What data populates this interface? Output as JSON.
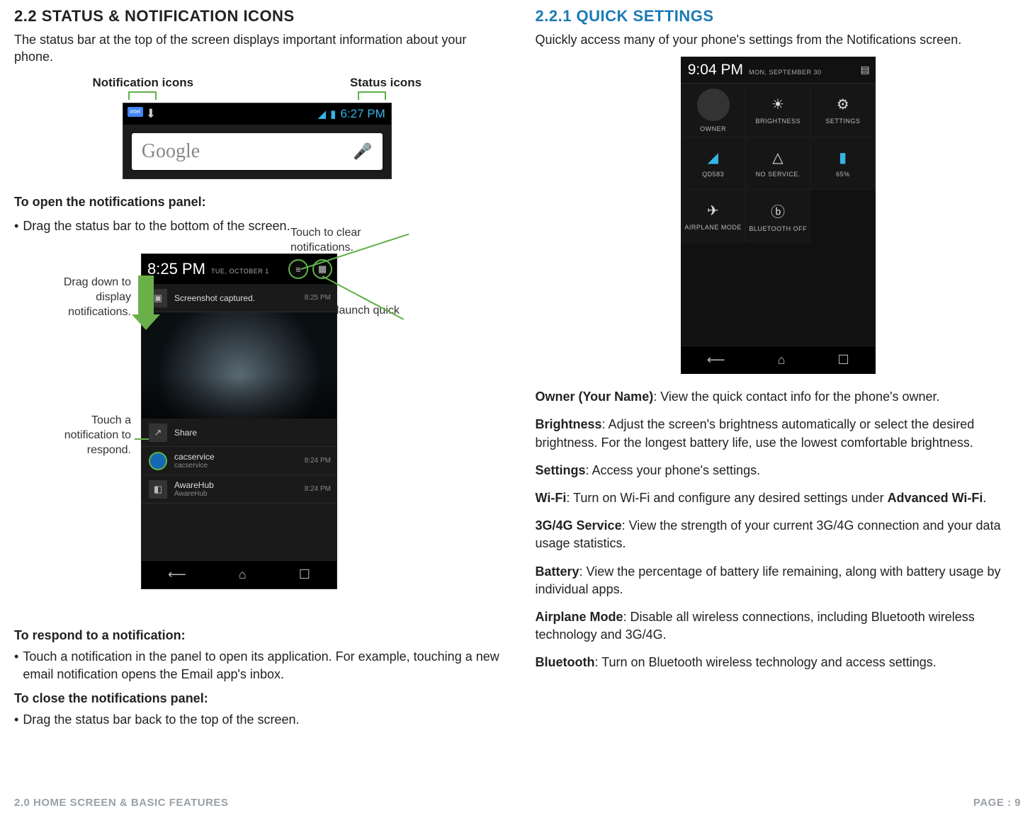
{
  "left": {
    "heading": "2.2 STATUS & NOTIFICATION ICONS",
    "intro": "The status bar at the top of the screen displays important information about your phone.",
    "labels": {
      "notif": "Notification icons",
      "status": "Status icons"
    },
    "fig1": {
      "clock": "6:27 PM",
      "search_brand": "Google",
      "intel": "intel"
    },
    "open_heading": "To open the notifications panel:",
    "open_bullet": "Drag the status bar to the bottom of the screen.",
    "fig2": {
      "time": "8:25 PM",
      "date": "TUE, OCTOBER 1",
      "row1": {
        "title": "Screenshot captured.",
        "ts": "8:25 PM"
      },
      "share": "Share",
      "row2": {
        "title": "cacservice",
        "sub": "cacservice",
        "ts": "8:24 PM"
      },
      "row3": {
        "title": "AwareHub",
        "sub": "AwareHub",
        "ts": "8:24 PM"
      }
    },
    "callouts": {
      "drag": "Drag down to display notifications.",
      "touch_notif": "Touch a notification to respond.",
      "clear": "Touch to clear notifications.",
      "qs": "Touch to launch quick settings."
    },
    "respond_heading": "To respond to a notification:",
    "respond_bullet": "Touch a notification in the panel to open its application. For example, touching a new email notification opens the Email app's inbox.",
    "close_heading": "To close the notifications panel:",
    "close_bullet": "Drag the status bar back to the top of the screen."
  },
  "right": {
    "heading": "2.2.1 QUICK SETTINGS",
    "intro": "Quickly access many of your phone's settings from the Notifications screen.",
    "fig3": {
      "time": "9:04 PM",
      "date": "MON, SEPTEMBER 30",
      "tiles": {
        "owner": "OWNER",
        "brightness": "BRIGHTNESS",
        "settings": "SETTINGS",
        "wifi": "QD583",
        "service": "NO SERVICE.",
        "battery": "65%",
        "airplane": "AIRPLANE MODE",
        "bt": "BLUETOOTH OFF"
      }
    },
    "defs": {
      "owner_l": "Owner (Your Name)",
      "owner_t": ": View the quick contact info for the phone's owner.",
      "bright_l": "Brightness",
      "bright_t": ": Adjust the screen's brightness automatically or select the desired brightness. For the longest battery life, use the lowest comfortable brightness.",
      "settings_l": "Settings",
      "settings_t": ": Access your phone's settings.",
      "wifi_l": "Wi-Fi",
      "wifi_t1": ": Turn on Wi-Fi and configure any desired settings under ",
      "wifi_b": "Advanced Wi-Fi",
      "wifi_t2": ".",
      "svc_l": "3G/4G Service",
      "svc_t": ": View the strength of your current 3G/4G connection and your data usage statistics.",
      "batt_l": "Battery",
      "batt_t": ": View the percentage of battery life remaining, along with battery usage by individual apps.",
      "air_l": "Airplane Mode",
      "air_t": ": Disable all wireless connections, including Bluetooth wireless technology and 3G/4G.",
      "bt_l": "Bluetooth",
      "bt_t": ": Turn on Bluetooth wireless technology and access settings."
    }
  },
  "footer": {
    "left": "2.0 HOME SCREEN & BASIC FEATURES",
    "right": "PAGE : 9"
  }
}
